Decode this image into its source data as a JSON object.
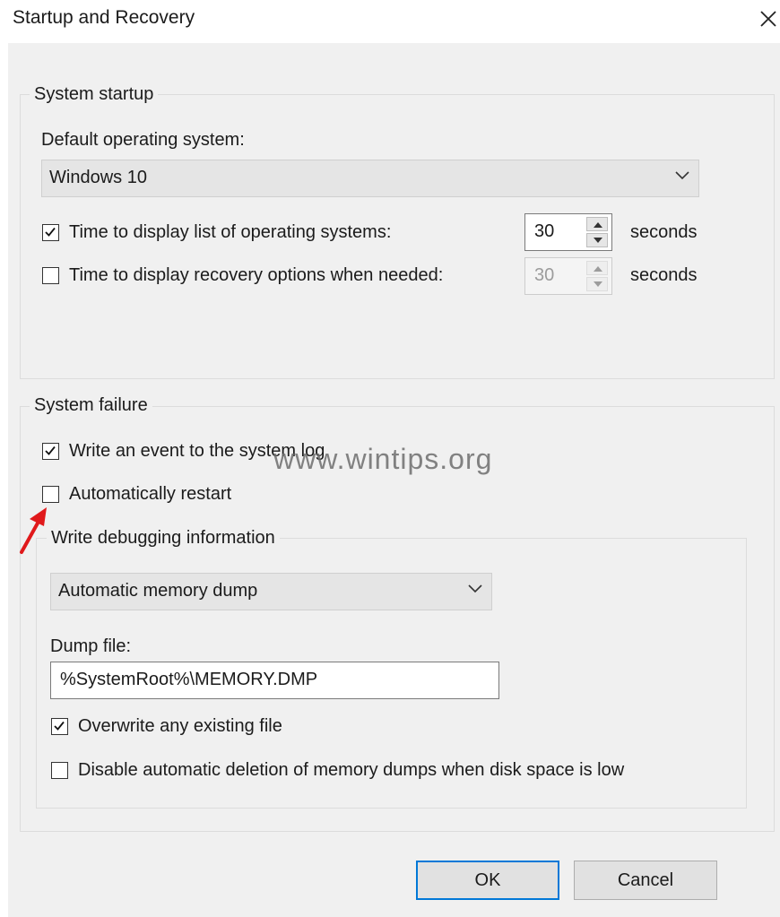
{
  "window": {
    "title": "Startup and Recovery"
  },
  "system_startup": {
    "group_label": "System startup",
    "default_os_label": "Default operating system:",
    "default_os_value": "Windows 10",
    "display_list": {
      "checked": true,
      "label": "Time to display list of operating systems:",
      "value": "30",
      "unit": "seconds"
    },
    "display_recovery": {
      "checked": false,
      "label": "Time to display recovery options when needed:",
      "value": "30",
      "unit": "seconds"
    }
  },
  "system_failure": {
    "group_label": "System failure",
    "write_event": {
      "checked": true,
      "label": "Write an event to the system log"
    },
    "auto_restart": {
      "checked": false,
      "label": "Automatically restart"
    },
    "debugging": {
      "group_label": "Write debugging information",
      "dump_type": "Automatic memory dump",
      "dump_file_label": "Dump file:",
      "dump_file_value": "%SystemRoot%\\MEMORY.DMP",
      "overwrite": {
        "checked": true,
        "label": "Overwrite any existing file"
      },
      "disable_deletion": {
        "checked": false,
        "label": "Disable automatic deletion of memory dumps when disk space is low"
      }
    }
  },
  "buttons": {
    "ok": "OK",
    "cancel": "Cancel"
  },
  "watermark": "www.wintips.org",
  "colors": {
    "accent": "#0078d7",
    "annotation_arrow": "#e0191b"
  }
}
